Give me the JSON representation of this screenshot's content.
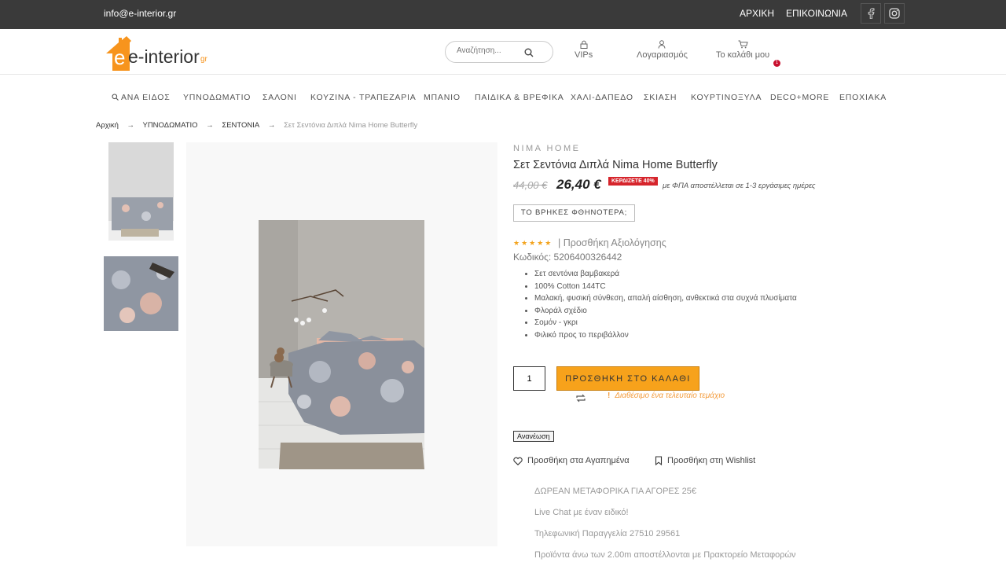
{
  "topbar": {
    "email": "info@e-interior.gr",
    "links": [
      "ΑΡΧΙΚΗ",
      "ΕΠΙΚΟΙΝΩΝΙΑ"
    ]
  },
  "header": {
    "logo_text": "e-interior",
    "logo_suffix": "gr",
    "search_placeholder": "Αναζήτηση...",
    "vips_label": "VIPs",
    "account_label": "Λογαριασμός",
    "cart_label": "Το καλάθι μου",
    "cart_count": "1"
  },
  "nav": {
    "items": [
      "ΑΝΑ ΕΙΔΟΣ",
      "ΥΠΝΟΔΩΜΑΤΙΟ",
      "ΣΑΛΟΝΙ",
      "ΚΟΥΖΙΝΑ - ΤΡΑΠΕΖΑΡΙΑ",
      "ΜΠΑΝΙΟ",
      "ΠΑΙΔΙΚΑ & ΒΡΕΦΙΚΑ",
      "ΧΑΛΙ-ΔΑΠΕΔΟ",
      "ΣΚΙΑΣΗ",
      "ΚΟΥΡΤΙΝΟΞΥΛΑ",
      "DECO+MORE",
      "ΕΠΟΧΙΑΚΑ"
    ]
  },
  "breadcrumb": {
    "items": [
      "Αρχική",
      "ΥΠΝΟΔΩΜΑΤΙΟ",
      "ΣΕΝΤΟΝΙΑ"
    ],
    "current": "Σετ Σεντόνια Διπλά Nima Home Butterfly",
    "separator": "→"
  },
  "product": {
    "brand": "NIMA HOME",
    "title": "Σετ Σεντόνια Διπλά Nima Home Butterfly",
    "old_price": "44,00 €",
    "new_price": "26,40 €",
    "save_badge": "ΚΕΡΔΙΖΕΤΕ 40%",
    "vat_note": "με ΦΠΑ αποστέλλεται σε 1-3 εργάσιμες ημέρες",
    "cheaper_button": "ΤΟ ΒΡΗΚΕΣ ΦΘΗΝΟΤΕΡΑ;",
    "stars": "★★★★★",
    "review_link": "|  Προσθήκη Αξιολόγησης",
    "sku": "Κωδικός: 5206400326442",
    "features": [
      "Σετ σεντόνια βαμβακερά",
      "100% Cotton 144TC",
      "Μαλακή, φυσική σύνθεση, απαλή αίσθηση, ανθεκτικά στα συχνά πλυσίματα",
      "Φλοράλ σχέδιο",
      "Σομόν - γκρι",
      "Φιλικό προς το περιβάλλον"
    ],
    "quantity": "1",
    "add_to_cart": "ΠΡΟΣΘΗΚΗ ΣΤΟ ΚΑΛΑΘΙ",
    "stock_mark": "!",
    "stock_note": "Διαθέσιμο ένα τελευταίο τεμάχιο",
    "renew_button": "Ανανέωση",
    "favorites": "Προσθήκη στα Αγαπημένα",
    "wishlist": "Προσθήκη στη Wishlist",
    "info_lines": [
      "ΔΩΡΕΑΝ ΜΕΤΑΦΟΡΙΚΑ ΓΙΑ ΑΓΟΡΕΣ 25€",
      "Live Chat με έναν ειδικό!",
      "Τηλεφωνική Παραγγελία 27510 29561",
      "Προϊόντα άνω των 2.00m αποστέλλονται με Πρακτορείο Μεταφορών"
    ]
  },
  "colors": {
    "topbar": "#3a3a3a",
    "accent": "#f7a21b",
    "sale": "#d6252c",
    "stock": "#f39c3d"
  }
}
